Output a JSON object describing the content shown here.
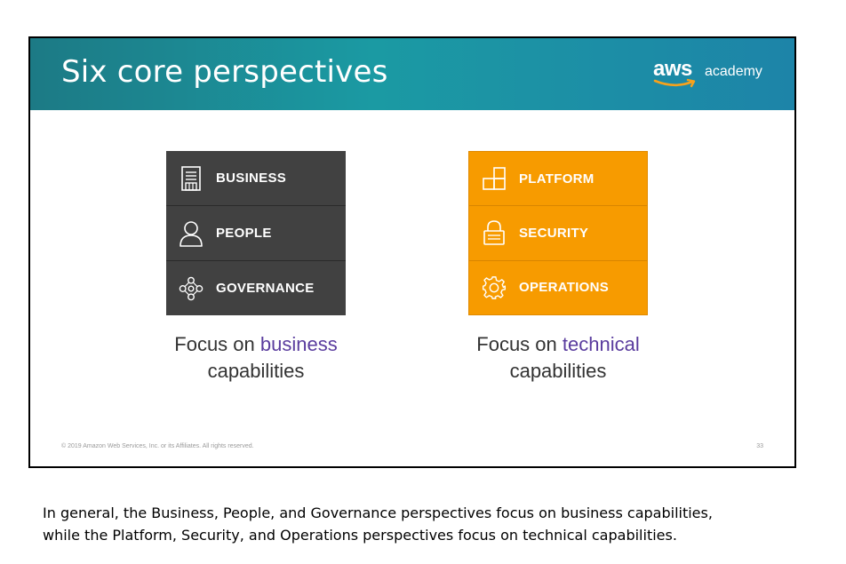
{
  "slide": {
    "title": "Six core perspectives",
    "logo": {
      "brand": "aws",
      "suffix": "academy"
    },
    "business_stack": {
      "items": [
        {
          "label": "BUSINESS",
          "icon": "building-icon"
        },
        {
          "label": "PEOPLE",
          "icon": "person-icon"
        },
        {
          "label": "GOVERNANCE",
          "icon": "network-nodes-icon"
        }
      ],
      "caption": {
        "pre": "Focus on ",
        "highlight": "business",
        "line2": "capabilities"
      }
    },
    "technical_stack": {
      "items": [
        {
          "label": "PLATFORM",
          "icon": "blocks-icon"
        },
        {
          "label": "SECURITY",
          "icon": "lock-icon"
        },
        {
          "label": "OPERATIONS",
          "icon": "gear-icon"
        }
      ],
      "caption": {
        "pre": "Focus on ",
        "highlight": "technical",
        "line2": "capabilities"
      }
    },
    "footer": {
      "copyright": "© 2019 Amazon Web Services, Inc. or its Affiliates. All rights reserved.",
      "page_number": "33"
    }
  },
  "notes": {
    "line1": "In general, the Business, People, and Governance perspectives focus on business capabilities,",
    "line2": "while the Platform, Security, and Operations perspectives focus on technical capabilities."
  },
  "colors": {
    "header_teal": "#1b9aa3",
    "business_bg": "#414141",
    "technical_bg": "#f79b00",
    "highlight_purple": "#5a3c9e"
  }
}
